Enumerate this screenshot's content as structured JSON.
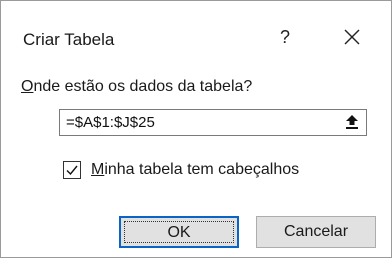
{
  "dialog": {
    "title": "Criar Tabela",
    "help_label": "?",
    "close_icon": "close-icon"
  },
  "prompt": {
    "accel": "O",
    "rest": "nde estão os dados da tabela?"
  },
  "range": {
    "value": "=$A$1:$J$25",
    "collapse_icon": "collapse-dialog-icon"
  },
  "headers_checkbox": {
    "checked": true,
    "accel": "M",
    "rest": "inha tabela tem cabeçalhos"
  },
  "buttons": {
    "ok_label": "OK",
    "cancel_label": "Cancelar"
  },
  "colors": {
    "accent": "#0a64c8",
    "button_face": "#e1e1e1"
  }
}
